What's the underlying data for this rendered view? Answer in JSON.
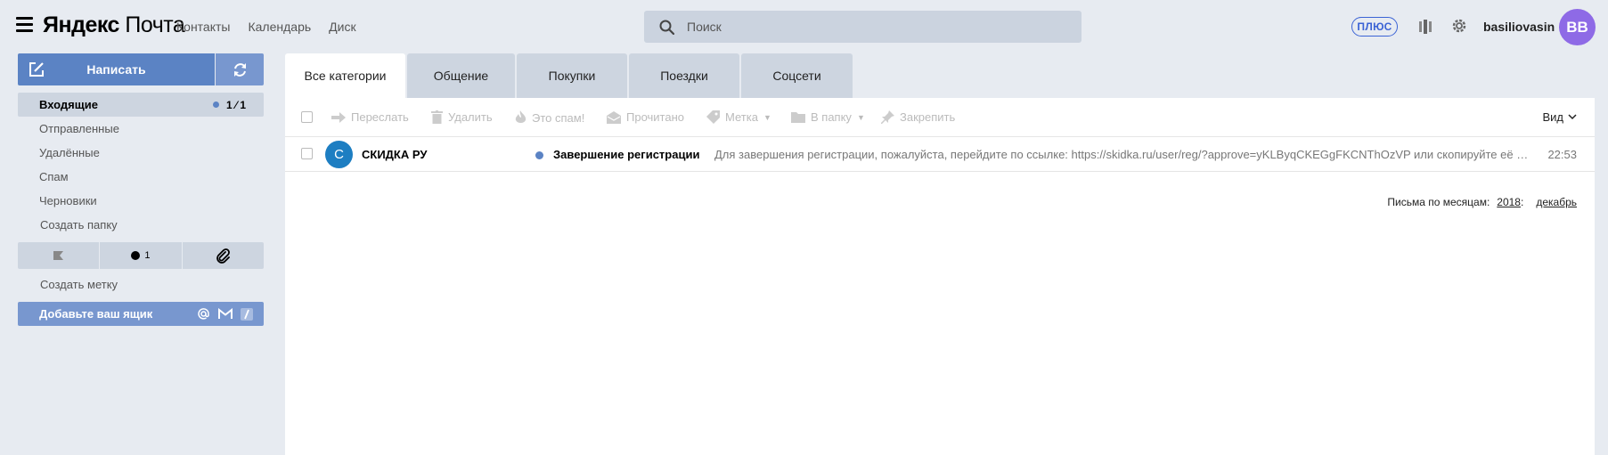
{
  "header": {
    "logo_brand": "Яндекс",
    "logo_service": "Почта",
    "nav": [
      "Контакты",
      "Календарь",
      "Диск"
    ],
    "search_placeholder": "Поиск",
    "plus_badge": "ПЛЮС",
    "username": "basiliovasin",
    "avatar_initials": "BB",
    "avatar_color": "#8e6ae6",
    "accent_color": "#3b63d5"
  },
  "sidebar": {
    "compose_label": "Написать",
    "folders": [
      {
        "label": "Входящие",
        "count": "1 ⁄ 1",
        "active": true
      },
      {
        "label": "Отправленные"
      },
      {
        "label": "Удалённые"
      },
      {
        "label": "Спам"
      },
      {
        "label": "Черновики"
      },
      {
        "label": "Создать папку"
      }
    ],
    "label_bar": {
      "unread_count": "1"
    },
    "create_label": "Создать метку",
    "add_mailbox": "Добавьте ваш ящик",
    "primary_color": "#5b83c4"
  },
  "tabs": [
    "Все категории",
    "Общение",
    "Покупки",
    "Поездки",
    "Соцсети"
  ],
  "toolbar": {
    "forward": "Переслать",
    "delete": "Удалить",
    "spam": "Это спам!",
    "read": "Прочитано",
    "label": "Метка",
    "to_folder": "В папку",
    "pin": "Закрепить",
    "view": "Вид"
  },
  "messages": [
    {
      "avatar_letter": "С",
      "sender": "СКИДКА РУ",
      "subject": "Завершение регистрации",
      "preview": "Для завершения регистрации, пожалуйста, перейдите по ссылке: https://skidka.ru/user/reg/?approve=yKLByqCKEGgFKCNThOzVP или скопируйте её в адресную строку браузера",
      "time": "22:53",
      "unread": true
    }
  ],
  "by_month": {
    "label": "Письма по месяцам:",
    "year": "2018",
    "month": "декабрь"
  }
}
